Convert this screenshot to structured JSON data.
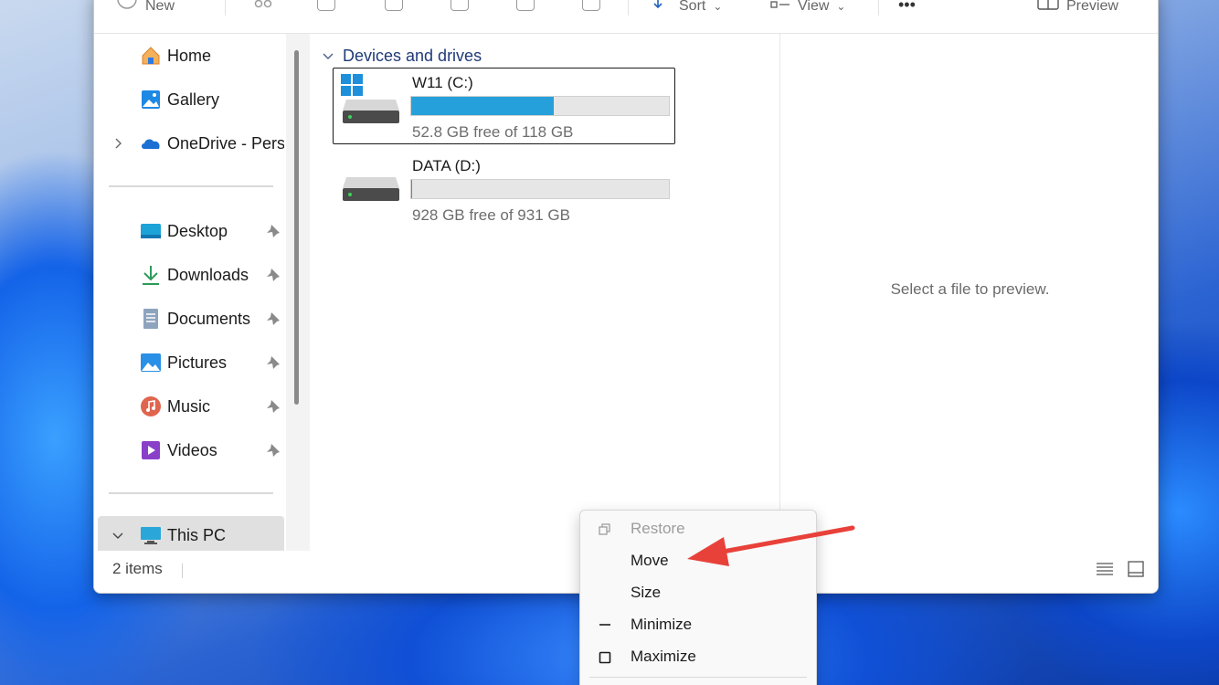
{
  "toolbar": {
    "new_label": "New",
    "sort_label": "Sort",
    "view_label": "View",
    "more_label": "•••",
    "preview_label": "Preview"
  },
  "sidebar": {
    "items": [
      {
        "label": "Home",
        "icon": "home-icon",
        "pinned": false
      },
      {
        "label": "Gallery",
        "icon": "gallery-icon",
        "pinned": false
      },
      {
        "label": "OneDrive - Perso",
        "icon": "onedrive-icon",
        "pinned": false
      },
      {
        "label": "Desktop",
        "icon": "desktop-folder-icon",
        "pinned": true
      },
      {
        "label": "Downloads",
        "icon": "downloads-icon",
        "pinned": true
      },
      {
        "label": "Documents",
        "icon": "documents-icon",
        "pinned": true
      },
      {
        "label": "Pictures",
        "icon": "pictures-icon",
        "pinned": true
      },
      {
        "label": "Music",
        "icon": "music-icon",
        "pinned": true
      },
      {
        "label": "Videos",
        "icon": "videos-icon",
        "pinned": true
      },
      {
        "label": "This PC",
        "icon": "this-pc-icon",
        "pinned": false
      }
    ]
  },
  "main": {
    "group_title": "Devices and drives",
    "drives": [
      {
        "name": "W11 (C:)",
        "free_text": "52.8 GB free of 118 GB",
        "used_fraction": 0.553,
        "selected": true
      },
      {
        "name": "DATA (D:)",
        "free_text": "928 GB free of 931 GB",
        "used_fraction": 0.003,
        "selected": false
      }
    ]
  },
  "preview": {
    "message": "Select a file to preview."
  },
  "status": {
    "item_count": "2 items"
  },
  "context_menu": {
    "items": [
      {
        "label": "Restore",
        "enabled": false
      },
      {
        "label": "Move",
        "enabled": true
      },
      {
        "label": "Size",
        "enabled": true
      },
      {
        "label": "Minimize",
        "enabled": true
      },
      {
        "label": "Maximize",
        "enabled": true
      }
    ]
  },
  "colors": {
    "accent": "#26a0da",
    "annotation_arrow": "#e8413a"
  }
}
